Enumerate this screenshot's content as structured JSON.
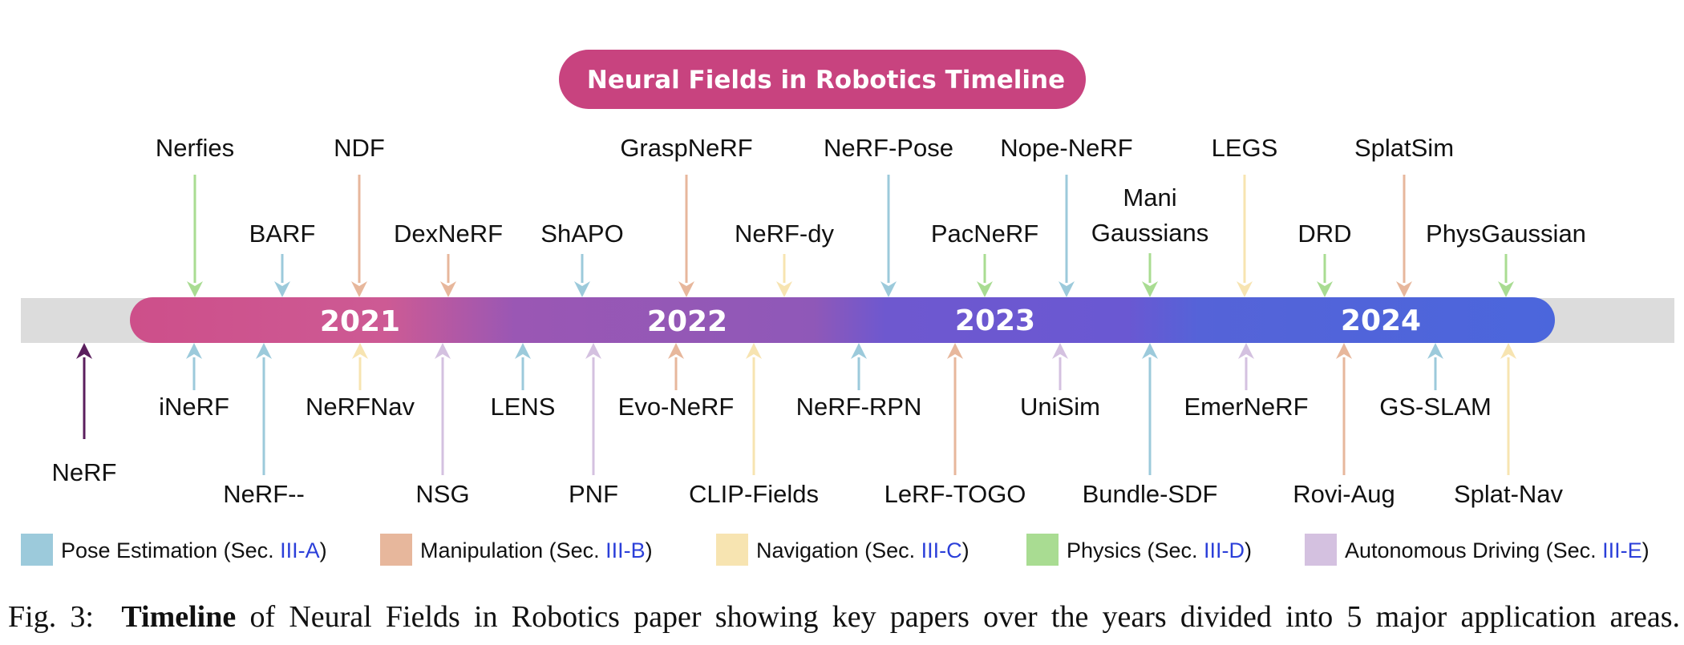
{
  "title": "Neural Fields in Robotics Timeline",
  "colors": {
    "title_bg": "#c8437f",
    "track": "#dcdcdc",
    "pose": "#9ccadb",
    "manipulation": "#e7b79c",
    "navigation": "#f7e4b1",
    "physics": "#a9dc92",
    "autonomous": "#d4c1e0",
    "nerf": "#5b1f5e"
  },
  "years": [
    {
      "label": "2021",
      "color": "#cd4f8a"
    },
    {
      "label": "2022",
      "color": "#9356b4"
    },
    {
      "label": "2023",
      "color": "#6a56cf"
    },
    {
      "label": "2024",
      "color": "#4f63d9"
    }
  ],
  "papers_above": [
    {
      "name": "Nerfies",
      "category": "physics",
      "tier": "high"
    },
    {
      "name": "BARF",
      "category": "pose",
      "tier": "low"
    },
    {
      "name": "NDF",
      "category": "manipulation",
      "tier": "high"
    },
    {
      "name": "DexNeRF",
      "category": "manipulation",
      "tier": "low"
    },
    {
      "name": "ShAPO",
      "category": "pose",
      "tier": "low"
    },
    {
      "name": "GraspNeRF",
      "category": "manipulation",
      "tier": "high"
    },
    {
      "name": "NeRF-dy",
      "category": "navigation",
      "tier": "low"
    },
    {
      "name": "NeRF-Pose",
      "category": "pose",
      "tier": "high"
    },
    {
      "name": "PacNeRF",
      "category": "physics",
      "tier": "low"
    },
    {
      "name": "Nope-NeRF",
      "category": "pose",
      "tier": "high"
    },
    {
      "name": "Mani Gaussians",
      "category": "physics",
      "tier": "low"
    },
    {
      "name": "LEGS",
      "category": "navigation",
      "tier": "high"
    },
    {
      "name": "DRD",
      "category": "physics",
      "tier": "low"
    },
    {
      "name": "SplatSim",
      "category": "manipulation",
      "tier": "high"
    },
    {
      "name": "PhysGaussian",
      "category": "physics",
      "tier": "low"
    }
  ],
  "papers_below": [
    {
      "name": "NeRF",
      "category": "nerf",
      "tier": "far"
    },
    {
      "name": "iNeRF",
      "category": "pose",
      "tier": "near"
    },
    {
      "name": "NeRF--",
      "category": "pose",
      "tier": "far"
    },
    {
      "name": "NeRFNav",
      "category": "navigation",
      "tier": "near"
    },
    {
      "name": "NSG",
      "category": "autonomous",
      "tier": "far"
    },
    {
      "name": "LENS",
      "category": "pose",
      "tier": "near"
    },
    {
      "name": "PNF",
      "category": "autonomous",
      "tier": "far"
    },
    {
      "name": "Evo-NeRF",
      "category": "manipulation",
      "tier": "near"
    },
    {
      "name": "CLIP-Fields",
      "category": "navigation",
      "tier": "far"
    },
    {
      "name": "NeRF-RPN",
      "category": "pose",
      "tier": "near"
    },
    {
      "name": "LeRF-TOGO",
      "category": "manipulation",
      "tier": "far"
    },
    {
      "name": "UniSim",
      "category": "autonomous",
      "tier": "near"
    },
    {
      "name": "Bundle-SDF",
      "category": "pose",
      "tier": "far"
    },
    {
      "name": "EmerNeRF",
      "category": "autonomous",
      "tier": "near"
    },
    {
      "name": "Rovi-Aug",
      "category": "manipulation",
      "tier": "far"
    },
    {
      "name": "GS-SLAM",
      "category": "pose",
      "tier": "near"
    },
    {
      "name": "Splat-Nav",
      "category": "navigation",
      "tier": "far"
    }
  ],
  "legend": [
    {
      "category": "pose",
      "label": "Pose Estimation (Sec. ",
      "ref": "III-A",
      "suffix": ")"
    },
    {
      "category": "manipulation",
      "label": "Manipulation (Sec. ",
      "ref": "III-B",
      "suffix": ")"
    },
    {
      "category": "navigation",
      "label": "Navigation (Sec. ",
      "ref": "III-C",
      "suffix": ")"
    },
    {
      "category": "physics",
      "label": "Physics (Sec. ",
      "ref": "III-D",
      "suffix": ")"
    },
    {
      "category": "autonomous",
      "label": "Autonomous Driving (Sec. ",
      "ref": "III-E",
      "suffix": ")"
    }
  ],
  "caption": {
    "prefix": "Fig. 3:",
    "bold": "Timeline",
    "rest": "of Neural Fields in Robotics paper showing key papers over the years divided into 5 major application areas."
  }
}
